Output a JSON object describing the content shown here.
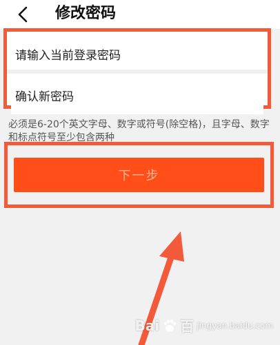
{
  "header": {
    "title": "修改密码",
    "back_icon": "chevron-left-icon"
  },
  "form": {
    "current_password_placeholder": "请输入当前登录密码",
    "new_password_placeholder": "确认新密码"
  },
  "hint": "必须是6-20个英文字母、数字或符号(除空格)，且字母、数字和标点符号至少包含两种",
  "next_button": {
    "label": "下一步",
    "bg_color": "#ff4e17",
    "text_color": "#ffb899"
  },
  "annotation": {
    "highlight_color": "#f35a3a"
  },
  "watermark": {
    "brand": "Bai",
    "brand_suffix": "百",
    "sub": "jingyan.baidu.com"
  }
}
